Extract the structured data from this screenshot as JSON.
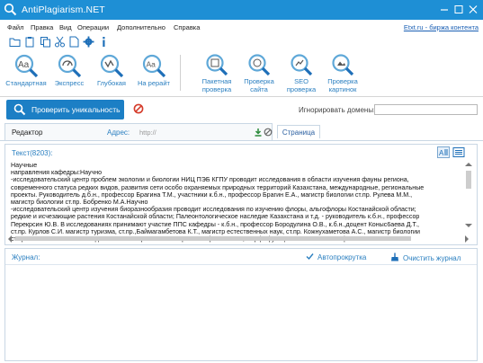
{
  "window": {
    "title": "AntiPlagiarism.NET",
    "accent": "#1e8fd5",
    "controls": [
      "minimize-icon",
      "maximize-icon",
      "close-icon"
    ]
  },
  "menu": {
    "items": [
      "Файл",
      "Правка",
      "Вид",
      "Операции",
      "Дополнительно",
      "Справка"
    ],
    "etxt_link": "Etxt.ru - биржа контента"
  },
  "toolbar_icons": [
    "folder-open-icon",
    "paste-icon",
    "copy-icon",
    "cut-icon",
    "document-icon",
    "gear-icon",
    "info-icon"
  ],
  "ribbon": {
    "buttons": [
      {
        "label": "Стандартная",
        "icon": "search-aa-icon"
      },
      {
        "label": "Экспресс",
        "icon": "search-speed-icon"
      },
      {
        "label": "Глубокая",
        "icon": "search-deep-icon"
      },
      {
        "label": "На рерайт",
        "icon": "search-rewrite-icon"
      },
      {
        "label": "Пакетная\nпроверка",
        "icon": "search-batch-icon"
      },
      {
        "label": "Проверка\nсайта",
        "icon": "search-site-icon"
      },
      {
        "label": "SEO\nпроверка",
        "icon": "search-seo-icon"
      },
      {
        "label": "Проверка\nкартинок",
        "icon": "search-images-icon"
      }
    ]
  },
  "actions": {
    "check_button": "Проверить уникальность",
    "stop_icon": "stop-icon",
    "ignore_domains_label": "Игнорировать домены:",
    "ignore_domains_value": ""
  },
  "editor": {
    "tab_label": "Редактор",
    "address_label": "Адрес:",
    "address_placeholder": "http://",
    "page_tab": "Страница"
  },
  "text_panel": {
    "label": "Текст(8203):",
    "lines": [
      "Научные",
      " направления кафедры:Научно",
      "-исследовательский центр проблем экологии и биологии НИЦ ПЭБ КГПУ проводит исследования в  области изучения фауны региона,",
      "современного статуса редких видов, развития сети особо охраняемых природных территорий Казахстана, международные, региональные",
      "проекты. Руководитель д.б.н.,  профессор Брагина Т.М., участники к.б.н., профессор Брагин Е.А., магистр биологии ст.пр. Рулева М.М.,",
      "магистр биологии ст.пр. Бобренко М.А.Научно",
      "-исследовательский центр изучения биоразнообразия проводит  исследования по изучению флоры, альгофлоры Костанайской области;",
      "редкие и исчезающие растения Костанайской области; Палеонтологическое наследие Казахстана и т.д. - руководитель к.б.н., профессор",
      "Перекрсин Ю.В.  В исследованиях принимают участие ППС кафедры - к.б.н., профессор Бородулина О.В., к.б.н.,доцент Коныс6аева Д.Т.,",
      "ст.пр. Курлов С.И. магистр туризма, ст.пр.,Баймагамбетова К.Т., магистр естественных наук, ст.пр. Кожнухаметова А.С., магистр биологии",
      "ст.пр. Боженкова Ж.Т. Исследования по направлению возрастная физиология, морфофункциональные и психофизиологические"
    ]
  },
  "journal": {
    "label": "Журнал:",
    "autoscroll_label": "Автопрокрутка",
    "autoscroll_checked": true,
    "clear_label": "Очистить журнал"
  }
}
